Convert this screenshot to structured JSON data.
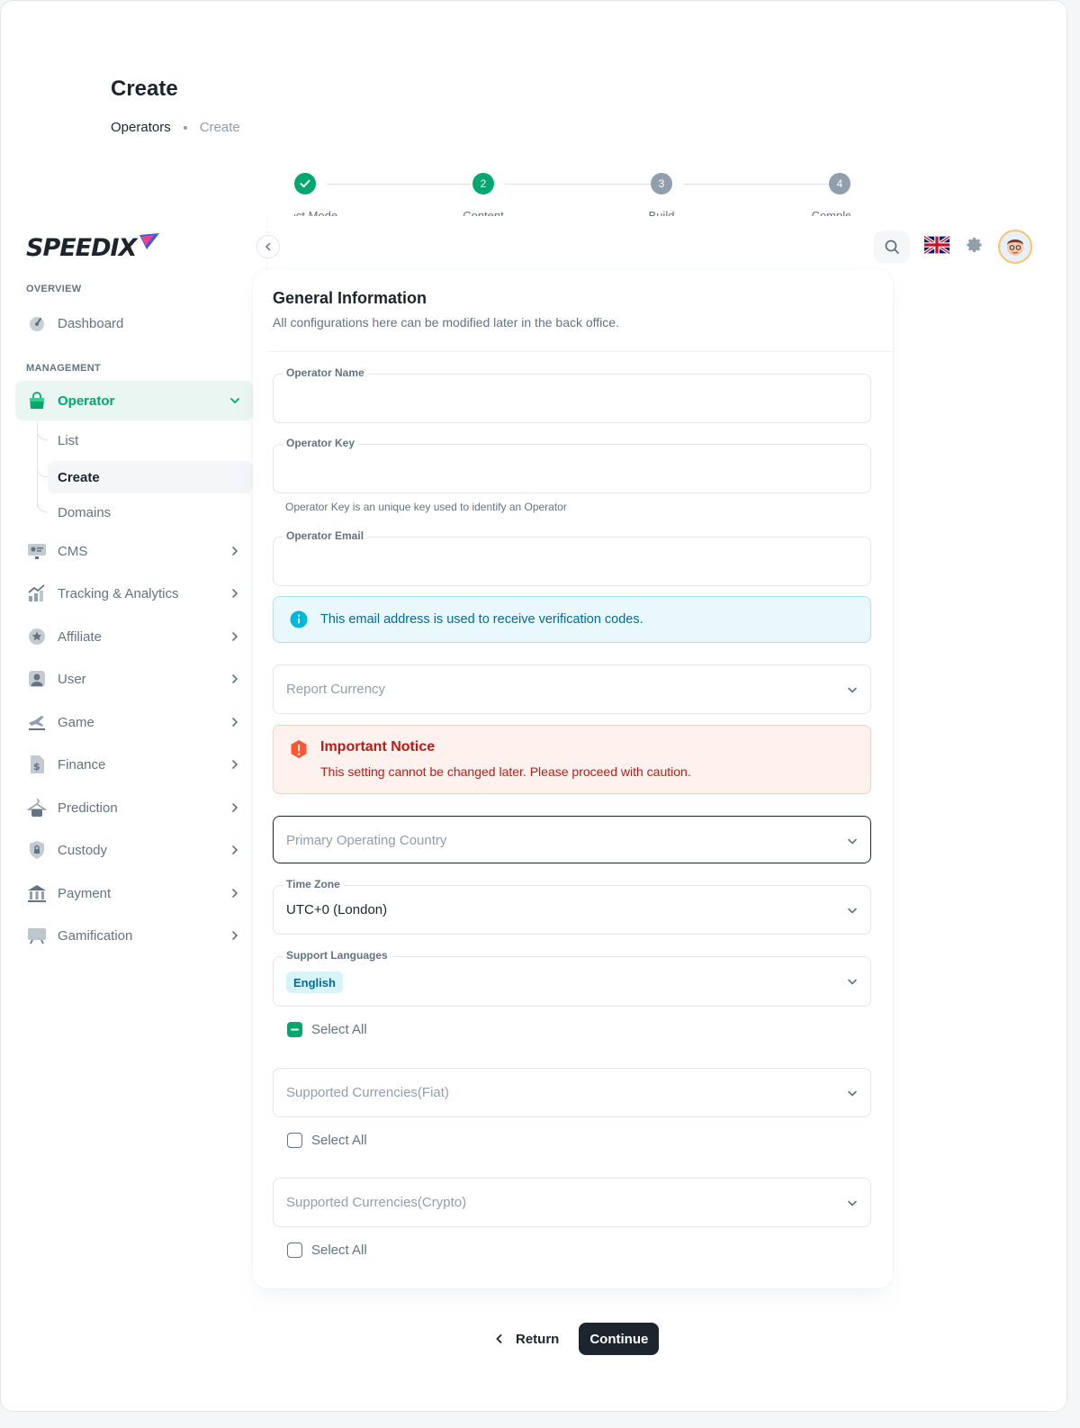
{
  "page": {
    "title": "Create"
  },
  "breadcrumbs": [
    "Operators",
    "Create"
  ],
  "stepper": {
    "steps": [
      {
        "label": "Select Mode",
        "state": "done"
      },
      {
        "label": "Content",
        "number": "2",
        "state": "active"
      },
      {
        "label": "Build",
        "number": "3",
        "state": "todo"
      },
      {
        "label": "Completed",
        "number": "4",
        "state": "todo"
      }
    ]
  },
  "sidebar": {
    "overview_label": "OVERVIEW",
    "management_label": "MANAGEMENT",
    "dashboard": "Dashboard",
    "operator": "Operator",
    "operator_sub": [
      "List",
      "Create",
      "Domains"
    ],
    "items": [
      "CMS",
      "Tracking & Analytics",
      "Affiliate",
      "User",
      "Game",
      "Finance",
      "Prediction",
      "Custody",
      "Payment",
      "Gamification"
    ]
  },
  "card": {
    "title": "General Information",
    "subtitle": "All configurations here can be modified later in the back office.",
    "operator_name": {
      "label": "Operator Name",
      "value": ""
    },
    "operator_key": {
      "label": "Operator Key",
      "value": "",
      "helper": "Operator Key is an unique key used to identify an Operator"
    },
    "operator_email": {
      "label": "Operator Email",
      "value": ""
    },
    "info_alert": "This email address is used to receive verification codes.",
    "report_currency": {
      "placeholder": "Report Currency"
    },
    "warn_alert": {
      "title": "Important Notice",
      "message": "This setting cannot be changed later. Please proceed with caution."
    },
    "primary_country": {
      "placeholder": "Primary Operating Country"
    },
    "time_zone": {
      "label": "Time Zone",
      "value": "UTC+0 (London)"
    },
    "support_languages": {
      "label": "Support Languages",
      "chips": [
        "English"
      ],
      "select_all": "Select All"
    },
    "fiat": {
      "placeholder": "Supported Currencies(Fiat)",
      "select_all": "Select All"
    },
    "crypto": {
      "placeholder": "Supported Currencies(Crypto)",
      "select_all": "Select All"
    }
  },
  "footer": {
    "return_label": "Return",
    "continue_label": "Continue"
  },
  "colors": {
    "primary": "#00a76f",
    "info": "#006c9c",
    "error": "#b71d18",
    "dark": "#1c252e"
  }
}
